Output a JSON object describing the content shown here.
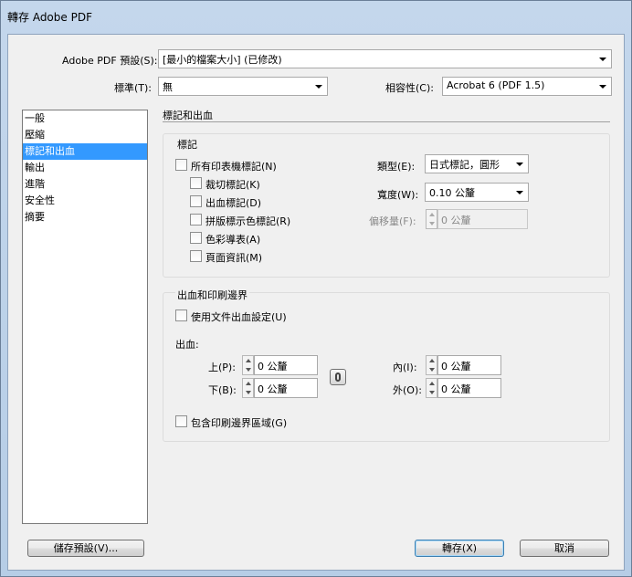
{
  "window": {
    "title": "轉存 Adobe PDF"
  },
  "header": {
    "preset_label": "Adobe PDF 預設(S):",
    "preset_value": "[最小的檔案大小] (已修改)",
    "standard_label": "標準(T):",
    "standard_value": "無",
    "compat_label": "相容性(C):",
    "compat_value": "Acrobat 6 (PDF 1.5)"
  },
  "sidebar": {
    "items": [
      "一般",
      "壓縮",
      "標記和出血",
      "輸出",
      "進階",
      "安全性",
      "摘要"
    ],
    "selected": "標記和出血"
  },
  "main": {
    "section_title": "標記和出血",
    "marks": {
      "group_label": "標記",
      "all_marks": "所有印表機標記(N)",
      "crop_marks": "裁切標記(K)",
      "bleed_marks": "出血標記(D)",
      "registration_marks": "拼版標示色標記(R)",
      "color_bars": "色彩導表(A)",
      "page_info": "頁面資訊(M)",
      "type_label": "類型(E):",
      "type_value": "日式標記，圓形",
      "weight_label": "寬度(W):",
      "weight_value": "0.10 公釐",
      "offset_label": "偏移量(F):",
      "offset_value": "0 公釐"
    },
    "bleed": {
      "group_label": "出血和印刷邊界",
      "use_doc_bleed": "使用文件出血設定(U)",
      "bleed_label": "出血:",
      "top_label": "上(P):",
      "top_value": "0 公釐",
      "bottom_label": "下(B):",
      "bottom_value": "0 公釐",
      "inside_label": "內(I):",
      "inside_value": "0 公釐",
      "outside_label": "外(O):",
      "outside_value": "0 公釐",
      "include_slug": "包含印刷邊界區域(G)"
    }
  },
  "footer": {
    "save_preset": "儲存預設(V)...",
    "export": "轉存(X)",
    "cancel": "取消"
  }
}
